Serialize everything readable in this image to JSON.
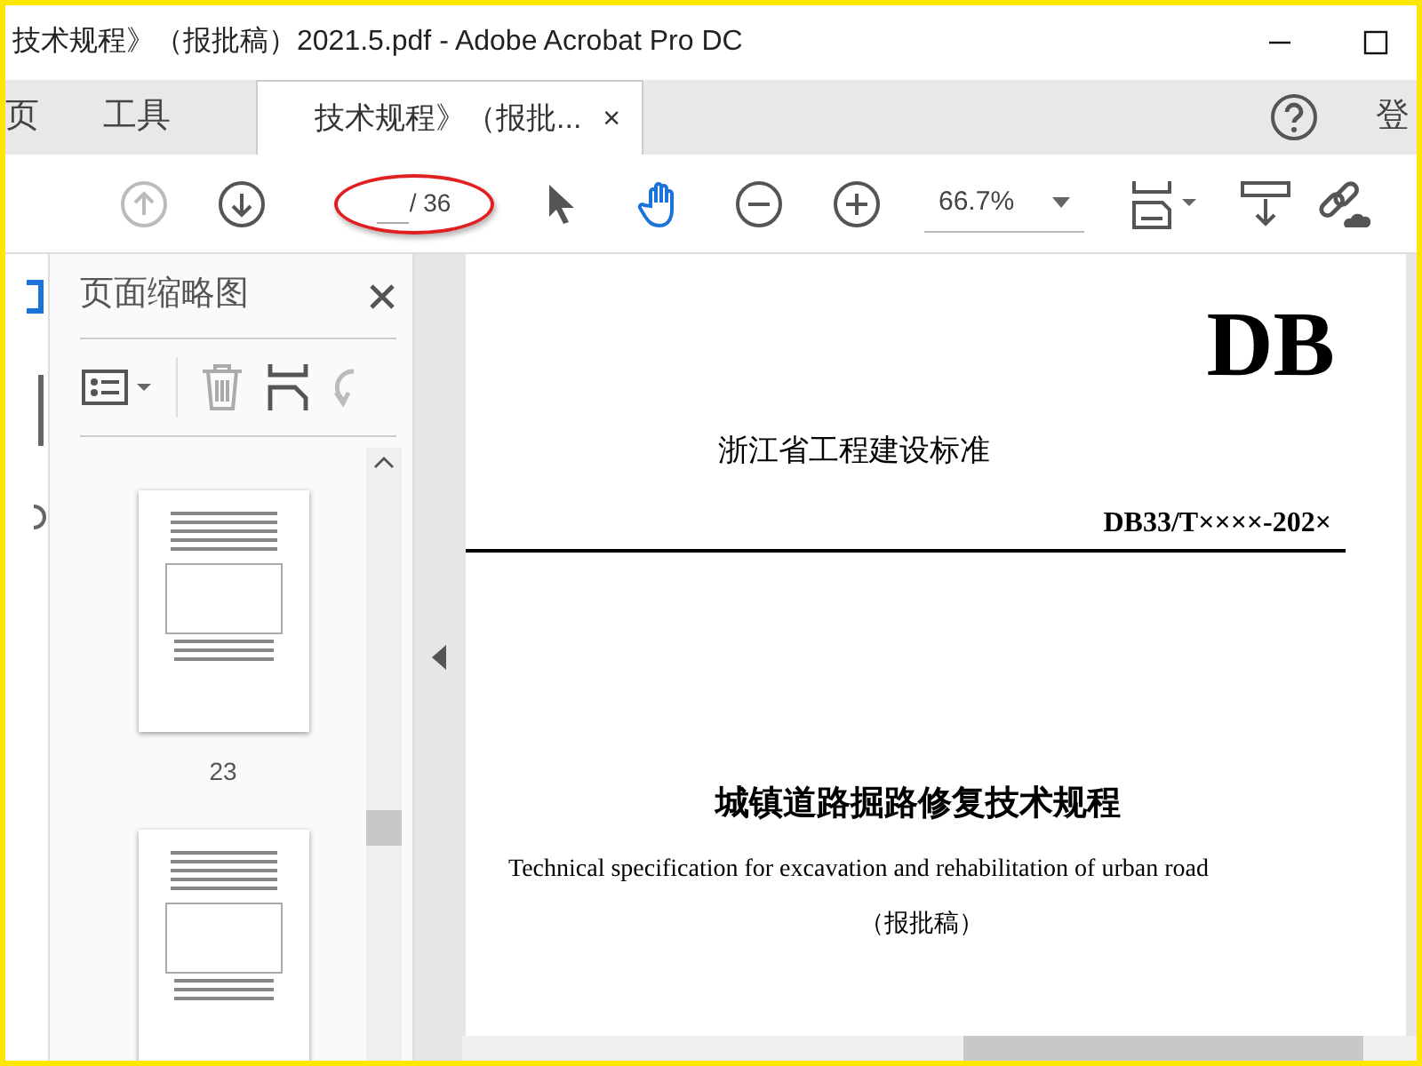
{
  "window": {
    "title": "技术规程》（报批稿）2021.5.pdf - Adobe Acrobat Pro DC"
  },
  "nav": [
    {
      "label": "页"
    },
    {
      "label": "工具"
    }
  ],
  "tabs": [
    {
      "label": "技术规程》（报批...",
      "selected": true,
      "close": "×"
    }
  ],
  "sign_in": "登",
  "toolbar": {
    "page_total": "/ 36",
    "zoom": "66.7%",
    "prev_disabled": true,
    "hand_selected": true
  },
  "thumbnails_panel": {
    "title": "页面缩略图",
    "pages": [
      {
        "kind": "full",
        "label": "23"
      },
      {
        "kind": "partial"
      }
    ]
  },
  "document": {
    "logo": "DB",
    "category": "浙江省工程建设标准",
    "code": "DB33/T××××-202×",
    "title_zh": "城镇道路掘路修复技术规程",
    "title_en": "Technical specification for excavation and rehabilitation of urban road",
    "status": "（报批稿）"
  }
}
